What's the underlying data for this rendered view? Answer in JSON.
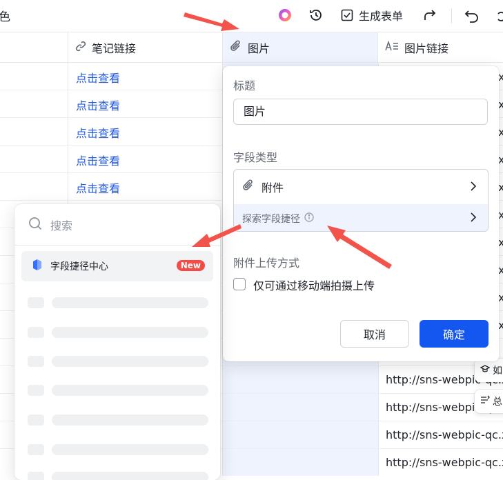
{
  "topbar": {
    "title_fragment": "色",
    "generate_form_label": "生成表单"
  },
  "columns": {
    "note_link": "笔记链接",
    "image": "图片",
    "image_link": "图片链接"
  },
  "rows": {
    "link_text": [
      "点击查看",
      "点击查看",
      "点击查看",
      "点击查看",
      "点击查看"
    ],
    "image_urls": [
      "http://sns-webpic-qc.x",
      "http://sns-webpic-qc.x",
      "http://sns-webpic-qc.x",
      "http://sns-webpic-qc.x"
    ]
  },
  "field_popup": {
    "title_label": "标题",
    "title_value": "图片",
    "field_type_label": "字段类型",
    "field_type_value": "附件",
    "explore_shortcut": "探索字段捷径",
    "upload_method_label": "附件上传方式",
    "mobile_only_checkbox": "仅可通过移动端拍摄上传",
    "mobile_only_checked": false,
    "cancel_label": "取消",
    "confirm_label": "确定"
  },
  "shortcut_panel": {
    "search_placeholder": "搜索",
    "shortcut_center": "字段捷径中心",
    "new_badge": "New"
  },
  "side_buttons": {
    "first_char": "如",
    "second_char": "总"
  },
  "colors": {
    "primary": "#1456f0",
    "link": "#245bdb",
    "badge": "#f54a45",
    "annotation_arrow": "#f2534b",
    "selected_column": "#eef3fd"
  }
}
